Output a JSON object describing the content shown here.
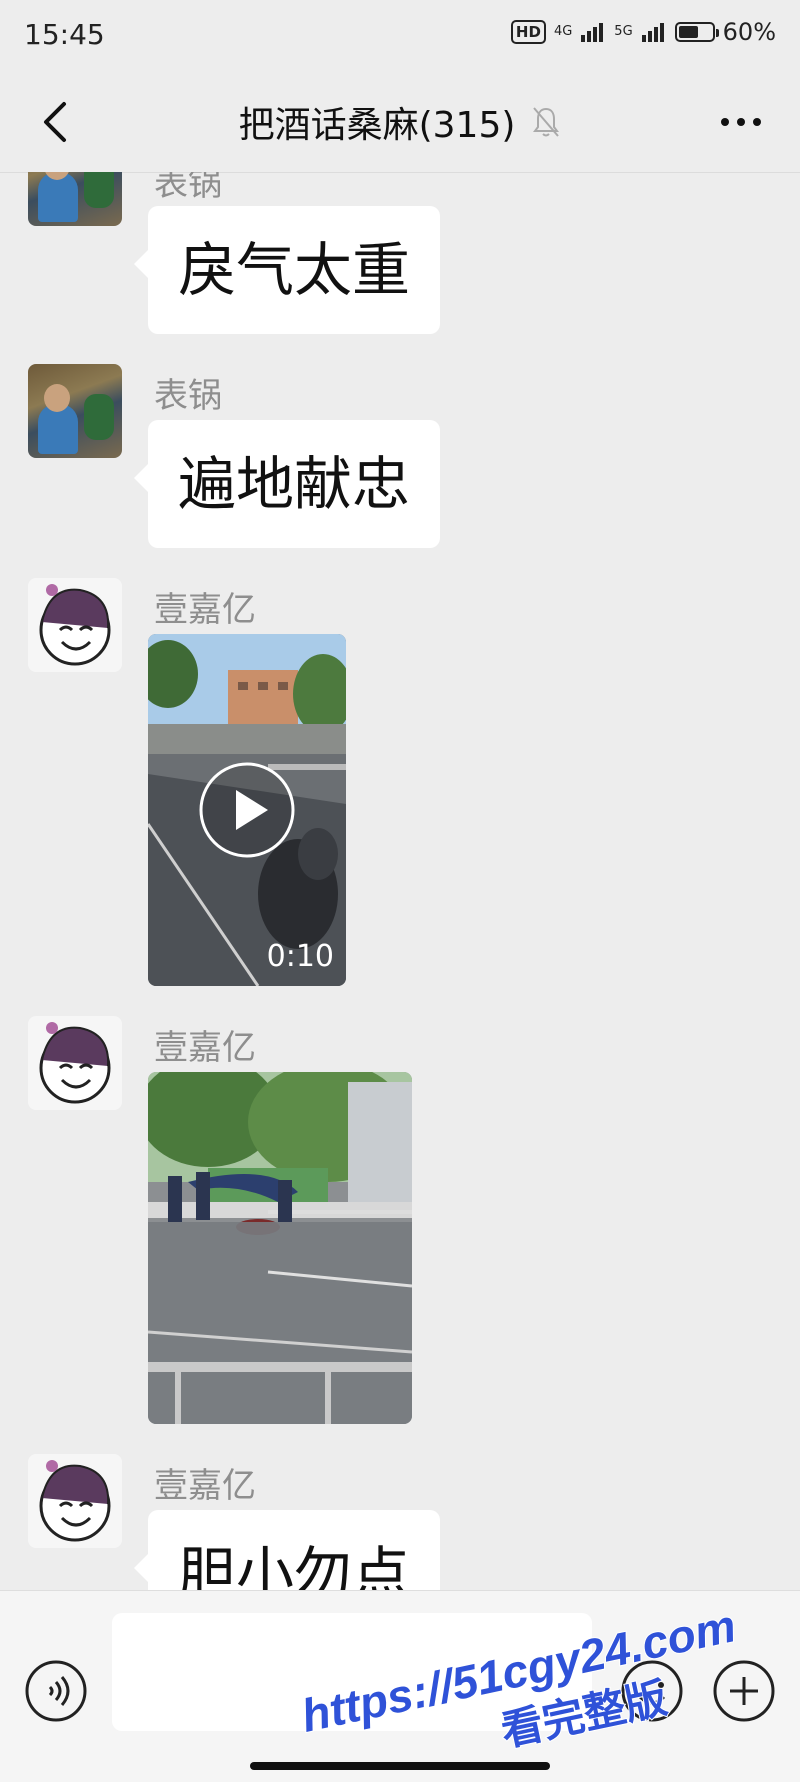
{
  "status_bar": {
    "time": "15:45",
    "hd_label": "HD",
    "net1": "4G",
    "net2": "5G",
    "battery_label": "60%",
    "battery_level": 0.6
  },
  "header": {
    "back_icon": "chevron-left-icon",
    "title": "把酒话桑麻(315)",
    "mute_icon": "bell-off-icon",
    "more_icon": "more-dots-icon"
  },
  "messages": [
    {
      "sender": "表锅",
      "type": "text",
      "text": "戾气太重"
    },
    {
      "sender": "表锅",
      "type": "text",
      "text": "遍地献忠"
    },
    {
      "sender": "壹嘉亿",
      "type": "video",
      "duration": "0:10",
      "play_icon": "play-icon"
    },
    {
      "sender": "壹嘉亿",
      "type": "image"
    },
    {
      "sender": "壹嘉亿",
      "type": "text",
      "text": "胆小勿点"
    }
  ],
  "input_bar": {
    "voice_icon": "voice-icon",
    "emoji_icon": "emoji-icon",
    "plus_icon": "plus-icon"
  },
  "watermark": {
    "line1": "https://51cgy24.com",
    "line2": "看完整版"
  },
  "colors": {
    "background": "#ededed",
    "bubble": "#ffffff",
    "nickname": "#8e8e8e",
    "watermark": "#2f52d8"
  }
}
